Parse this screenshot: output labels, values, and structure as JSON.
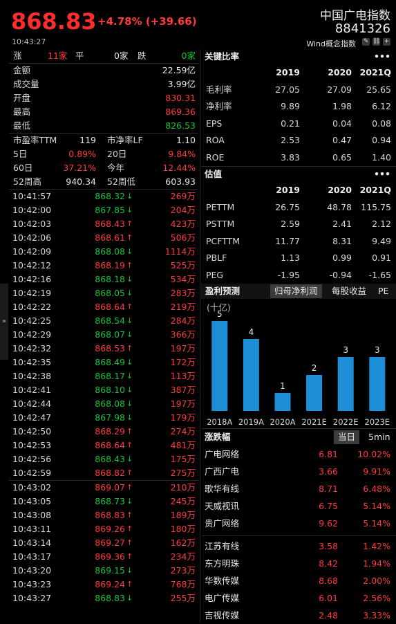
{
  "header": {
    "price": "868.83",
    "change": "+4.78% (+39.66)",
    "time": "10:43:27",
    "name": "中国广电指数",
    "code": "8841326",
    "sub": "Wind概念指数"
  },
  "stats": {
    "zd": {
      "up_label": "涨",
      "up": "11家",
      "flat_label": "平",
      "flat": "0家",
      "down_label": "跌",
      "down": "0家"
    },
    "items": [
      {
        "label": "金额",
        "value": "22.59亿",
        "cls": "white"
      },
      {
        "label": "成交量",
        "value": "3.99亿",
        "cls": "white"
      },
      {
        "label": "开盘",
        "value": "830.31",
        "cls": "red"
      },
      {
        "label": "最高",
        "value": "869.36",
        "cls": "red"
      },
      {
        "label": "最低",
        "value": "826.53",
        "cls": "green"
      }
    ],
    "pairs": [
      {
        "l1": "市盈率TTM",
        "v1": "119",
        "c1": "white",
        "l2": "市净率LF",
        "v2": "1.10",
        "c2": "white"
      },
      {
        "l1": "5日",
        "v1": "0.89%",
        "c1": "red",
        "l2": "20日",
        "v2": "9.84%",
        "c2": "red"
      },
      {
        "l1": "60日",
        "v1": "37.21%",
        "c1": "red",
        "l2": "今年",
        "v2": "12.44%",
        "c2": "red"
      },
      {
        "l1": "52周高",
        "v1": "940.34",
        "c1": "white",
        "l2": "52周低",
        "v2": "603.93",
        "c2": "white"
      }
    ]
  },
  "ticks": [
    {
      "t": "10:41:57",
      "p": "868.32",
      "d": "down",
      "v": "269万"
    },
    {
      "t": "10:42:00",
      "p": "867.85",
      "d": "down",
      "v": "204万"
    },
    {
      "t": "10:42:03",
      "p": "868.43",
      "d": "up",
      "v": "423万"
    },
    {
      "t": "10:42:06",
      "p": "868.61",
      "d": "up",
      "v": "506万"
    },
    {
      "t": "10:42:09",
      "p": "868.08",
      "d": "down",
      "v": "1114万"
    },
    {
      "t": "10:42:12",
      "p": "868.19",
      "d": "up",
      "v": "525万"
    },
    {
      "t": "10:42:16",
      "p": "868.18",
      "d": "down",
      "v": "534万"
    },
    {
      "t": "10:42:19",
      "p": "868.05",
      "d": "down",
      "v": "283万"
    },
    {
      "t": "10:42:22",
      "p": "868.64",
      "d": "up",
      "v": "219万"
    },
    {
      "t": "10:42:25",
      "p": "868.54",
      "d": "down",
      "v": "284万"
    },
    {
      "t": "10:42:29",
      "p": "868.07",
      "d": "down",
      "v": "366万"
    },
    {
      "t": "10:42:32",
      "p": "868.53",
      "d": "up",
      "v": "197万"
    },
    {
      "t": "10:42:35",
      "p": "868.49",
      "d": "down",
      "v": "172万"
    },
    {
      "t": "10:42:38",
      "p": "868.17",
      "d": "down",
      "v": "113万"
    },
    {
      "t": "10:42:41",
      "p": "868.10",
      "d": "down",
      "v": "387万"
    },
    {
      "t": "10:42:44",
      "p": "868.08",
      "d": "down",
      "v": "197万"
    },
    {
      "t": "10:42:47",
      "p": "867.98",
      "d": "down",
      "v": "179万"
    },
    {
      "t": "10:42:50",
      "p": "868.29",
      "d": "up",
      "v": "274万"
    },
    {
      "t": "10:42:53",
      "p": "868.64",
      "d": "up",
      "v": "481万"
    },
    {
      "t": "10:42:56",
      "p": "868.43",
      "d": "down",
      "v": "175万"
    },
    {
      "t": "10:42:59",
      "p": "868.82",
      "d": "up",
      "v": "275万"
    },
    {
      "t": "10:43:02",
      "p": "869.07",
      "d": "up",
      "v": "210万"
    },
    {
      "t": "10:43:05",
      "p": "868.73",
      "d": "down",
      "v": "245万"
    },
    {
      "t": "10:43:08",
      "p": "868.83",
      "d": "up",
      "v": "189万"
    },
    {
      "t": "10:43:11",
      "p": "869.26",
      "d": "up",
      "v": "180万"
    },
    {
      "t": "10:43:14",
      "p": "869.27",
      "d": "up",
      "v": "162万"
    },
    {
      "t": "10:43:17",
      "p": "869.36",
      "d": "up",
      "v": "234万"
    },
    {
      "t": "10:43:20",
      "p": "869.15",
      "d": "down",
      "v": "273万"
    },
    {
      "t": "10:43:23",
      "p": "869.24",
      "d": "up",
      "v": "768万"
    },
    {
      "t": "10:43:27",
      "p": "868.83",
      "d": "down",
      "v": "255万"
    }
  ],
  "ratios": {
    "title": "关键比率",
    "headers": [
      "2019",
      "2020",
      "2021Q"
    ],
    "rows": [
      {
        "label": "毛利率",
        "v": [
          "27.05",
          "27.09",
          "25.65"
        ]
      },
      {
        "label": "净利率",
        "v": [
          "9.89",
          "1.98",
          "6.12"
        ]
      },
      {
        "label": "EPS",
        "v": [
          "0.21",
          "0.04",
          "0.08"
        ]
      },
      {
        "label": "ROA",
        "v": [
          "2.53",
          "0.47",
          "0.94"
        ]
      },
      {
        "label": "ROE",
        "v": [
          "3.83",
          "0.65",
          "1.40"
        ]
      }
    ]
  },
  "valuation": {
    "title": "估值",
    "headers": [
      "2019",
      "2020",
      "2021Q"
    ],
    "rows": [
      {
        "label": "PETTM",
        "v": [
          "26.75",
          "48.78",
          "115.75"
        ]
      },
      {
        "label": "PSTTM",
        "v": [
          "2.59",
          "2.41",
          "2.12"
        ]
      },
      {
        "label": "PCFTTM",
        "v": [
          "11.77",
          "8.31",
          "9.49"
        ]
      },
      {
        "label": "PBLF",
        "v": [
          "1.13",
          "0.99",
          "0.91"
        ]
      },
      {
        "label": "PEG",
        "v": [
          "-1.95",
          "-0.94",
          "-1.65"
        ]
      }
    ]
  },
  "forecast": {
    "title": "盈利预测",
    "tabs": [
      "归母净利润",
      "每股收益",
      "PE"
    ],
    "unit": "(十亿)",
    "icons": {
      "dots": "more-dots-icon"
    }
  },
  "chart_data": {
    "type": "bar",
    "categories": [
      "2018A",
      "2019A",
      "2020A",
      "2021E",
      "2022E",
      "2023E"
    ],
    "values": [
      5,
      4,
      1,
      2,
      3,
      3
    ],
    "ylabel": "(十亿)",
    "color": "#1e8fd6"
  },
  "movers": {
    "title": "涨跌幅",
    "tabs": [
      "当日",
      "5min"
    ],
    "group1": [
      {
        "n": "广电网络",
        "p": "6.81",
        "c": "10.02%"
      },
      {
        "n": "广西广电",
        "p": "3.66",
        "c": "9.91%"
      },
      {
        "n": "歌华有线",
        "p": "8.71",
        "c": "6.48%"
      },
      {
        "n": "天威视讯",
        "p": "6.75",
        "c": "5.14%"
      },
      {
        "n": "贵广网络",
        "p": "9.62",
        "c": "5.14%"
      }
    ],
    "group2": [
      {
        "n": "江苏有线",
        "p": "3.58",
        "c": "1.42%"
      },
      {
        "n": "东方明珠",
        "p": "8.42",
        "c": "1.94%"
      },
      {
        "n": "华数传媒",
        "p": "8.68",
        "c": "2.00%"
      },
      {
        "n": "电广传媒",
        "p": "6.01",
        "c": "2.56%"
      },
      {
        "n": "吉视传媒",
        "p": "2.48",
        "c": "3.33%"
      }
    ]
  },
  "colors": {
    "red": "#ff3b3b",
    "green": "#19c23a",
    "bar": "#1e8fd6"
  }
}
